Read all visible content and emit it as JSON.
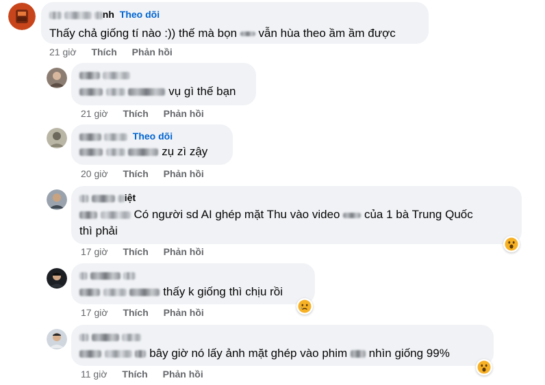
{
  "comments": [
    {
      "name_suffix": "nh",
      "follow": "Theo dõi",
      "text_a": "Thấy chả giống tí nào :)) thế mà bọn",
      "text_b": "vẫn hùa theo ầm ầm được",
      "time": "21 giờ",
      "like": "Thích",
      "reply": "Phản hồi"
    },
    {
      "text": "vụ gì thế bạn",
      "time": "21 giờ",
      "like": "Thích",
      "reply": "Phản hồi"
    },
    {
      "follow": "Theo dõi",
      "text": "zụ zì zậy",
      "time": "20 giờ",
      "like": "Thích",
      "reply": "Phản hồi"
    },
    {
      "name_suffix": "iệt",
      "text_line1_a": "Có người sd AI ghép mặt Thu vào video",
      "text_line1_b": "của 1 bà Trung Quốc",
      "text_line2": "thì phải",
      "time": "17 giờ",
      "like": "Thích",
      "reply": "Phản hồi",
      "reaction": "wow-emoji-icon"
    },
    {
      "text": "thấy k giống thì chịu rồi",
      "time": "17 giờ",
      "like": "Thích",
      "reply": "Phản hồi",
      "reaction": "sad-emoji-icon"
    },
    {
      "text_a": "bây giờ nó lấy ảnh mặt ghép vào phim",
      "text_b": "nhìn giống 99%",
      "time": "11 giờ",
      "like": "Thích",
      "reply": "Phản hồi",
      "reaction": "wow-emoji-icon"
    }
  ],
  "colors": {
    "bubble": "#f0f2f5",
    "link": "#0064d1",
    "meta": "#65676b",
    "reaction_yellow": "#f7b125"
  }
}
